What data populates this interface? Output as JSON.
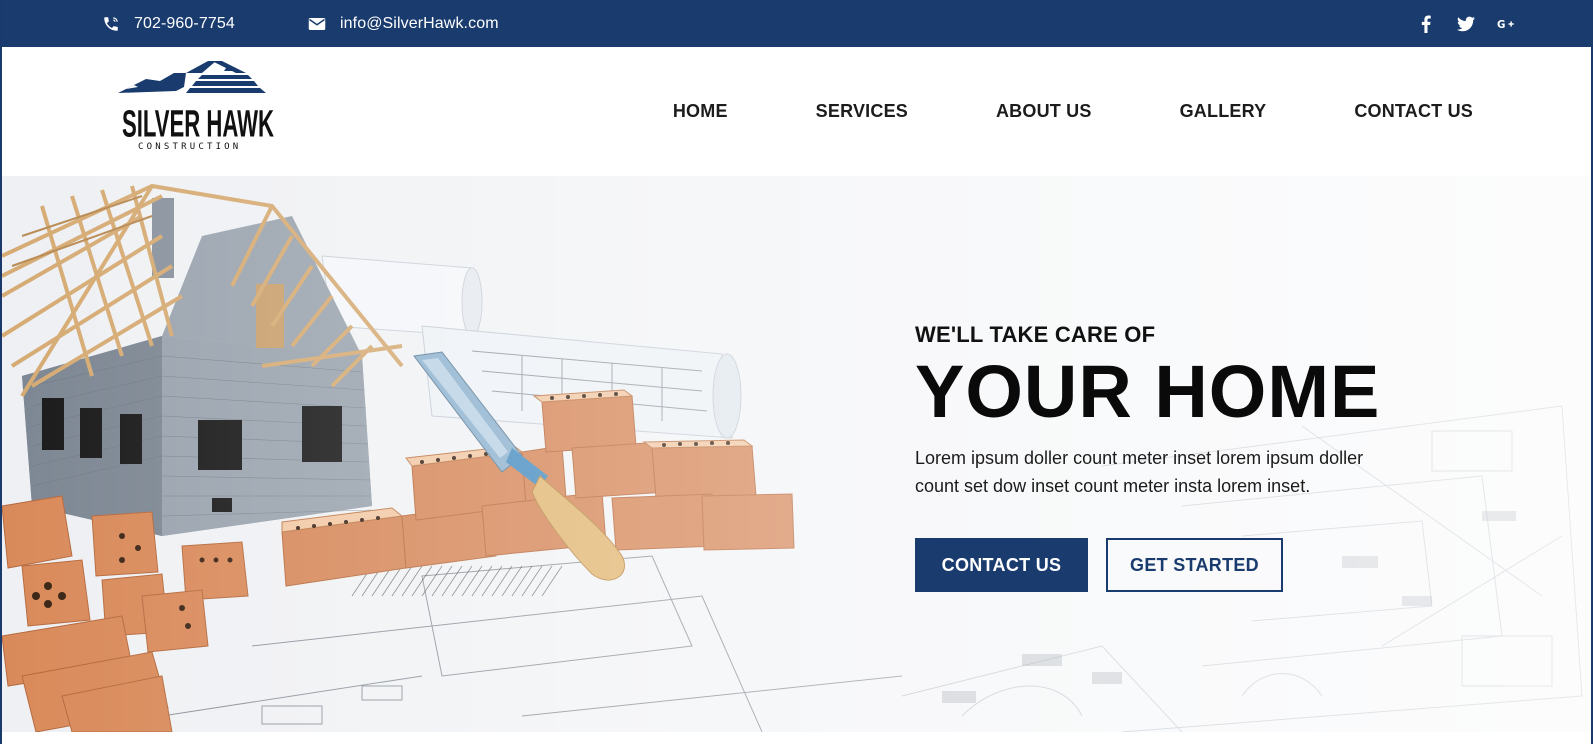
{
  "topbar": {
    "phone": "702-960-7754",
    "email": "info@SilverHawk.com",
    "phone_icon": "phone-icon",
    "email_icon": "envelope-icon",
    "social": [
      {
        "icon": "facebook-icon",
        "glyph": "f"
      },
      {
        "icon": "twitter-icon",
        "glyph": "t"
      },
      {
        "icon": "google-plus-icon",
        "glyph": "G+"
      }
    ],
    "bg_color": "#193b6e"
  },
  "logo": {
    "name_line1": "SILVER HAWK",
    "name_line2": "CONSTRUCTION"
  },
  "nav": {
    "items": [
      "HOME",
      "SERVICES",
      "ABOUT US",
      "GALLERY",
      "CONTACT US"
    ]
  },
  "hero": {
    "kicker": "WE'LL TAKE CARE OF",
    "headline": "YOUR HOME",
    "description": "Lorem ipsum doller count meter inset lorem ipsum doller count set dow inset count meter insta lorem inset.",
    "primary_button": "CONTACT US",
    "secondary_button": "GET STARTED",
    "accent_color": "#193b6e"
  }
}
